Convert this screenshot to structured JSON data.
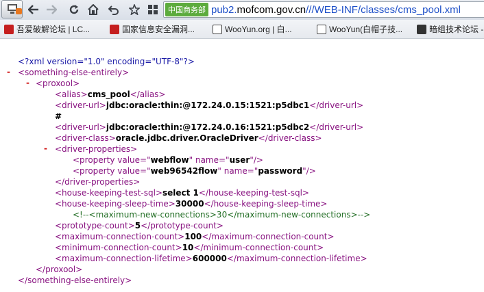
{
  "toolbar": {
    "site_badge": "中国商务部",
    "url_domain_prefix": "pub2.",
    "url_domain_host": "mofcom.gov.cn",
    "url_path": "///WEB-INF/classes/cms_pool.xml"
  },
  "bookmarks": [
    {
      "label": "吾爱破解论坛 | LC...",
      "icon": "red-logo-icon"
    },
    {
      "label": "国家信息安全漏洞...",
      "icon": "red-logo-icon"
    },
    {
      "label": "WooYun.org | 白...",
      "icon": "doc-icon"
    },
    {
      "label": "WooYun(白帽子技...",
      "icon": "doc-icon"
    },
    {
      "label": "暗组技术论坛 -",
      "icon": "dark-icon"
    }
  ],
  "xml": {
    "decl": "<?xml version=\"1.0\" encoding=\"UTF-8\"?>",
    "root_open": "<something-else-entirely>",
    "proxool_open": "<proxool>",
    "alias_open": "<alias>",
    "alias_value": "cms_pool",
    "alias_close": "</alias>",
    "driver_url_open": "<driver-url>",
    "driver_url_1": "jdbc:oracle:thin:@172.24.0.15:1521:p5dbc1",
    "driver_url_close": "</driver-url>",
    "hash": "#",
    "driver_url_2": "jdbc:oracle:thin:@172.24.0.16:1521:p5dbc2",
    "driver_class_open": "<driver-class>",
    "driver_class_value": "oracle.jdbc.driver.OracleDriver",
    "driver_class_close": "</driver-class>",
    "driver_props_open": "<driver-properties>",
    "prop1_start": "<property value=\"",
    "prop1_value": "webflow",
    "prop1_mid": "\" name=\"",
    "prop1_name": "user",
    "prop1_end": "\"/>",
    "prop2_value": "web96542flow",
    "prop2_name": "password",
    "driver_props_close": "</driver-properties>",
    "hk_sql_open": "<house-keeping-test-sql>",
    "hk_sql_value": "select 1",
    "hk_sql_close": "</house-keeping-test-sql>",
    "hk_sleep_open": "<house-keeping-sleep-time>",
    "hk_sleep_value": "30000",
    "hk_sleep_close": "</house-keeping-sleep-time>",
    "comment": "<!--<maximum-new-connections>30</maximum-new-connections>-->",
    "proto_open": "<prototype-count>",
    "proto_value": "5",
    "proto_close": "</prototype-count>",
    "maxconn_open": "<maximum-connection-count>",
    "maxconn_value": "100",
    "maxconn_close": "</maximum-connection-count>",
    "minconn_open": "<minimum-connection-count>",
    "minconn_value": "10",
    "minconn_close": "</minimum-connection-count>",
    "lifetime_open": "<maximum-connection-lifetime>",
    "lifetime_value": "600000",
    "lifetime_close": "</maximum-connection-lifetime>",
    "proxool_close": "</proxool>",
    "root_close": "</something-else-entirely>",
    "collapse_glyph": "-"
  }
}
